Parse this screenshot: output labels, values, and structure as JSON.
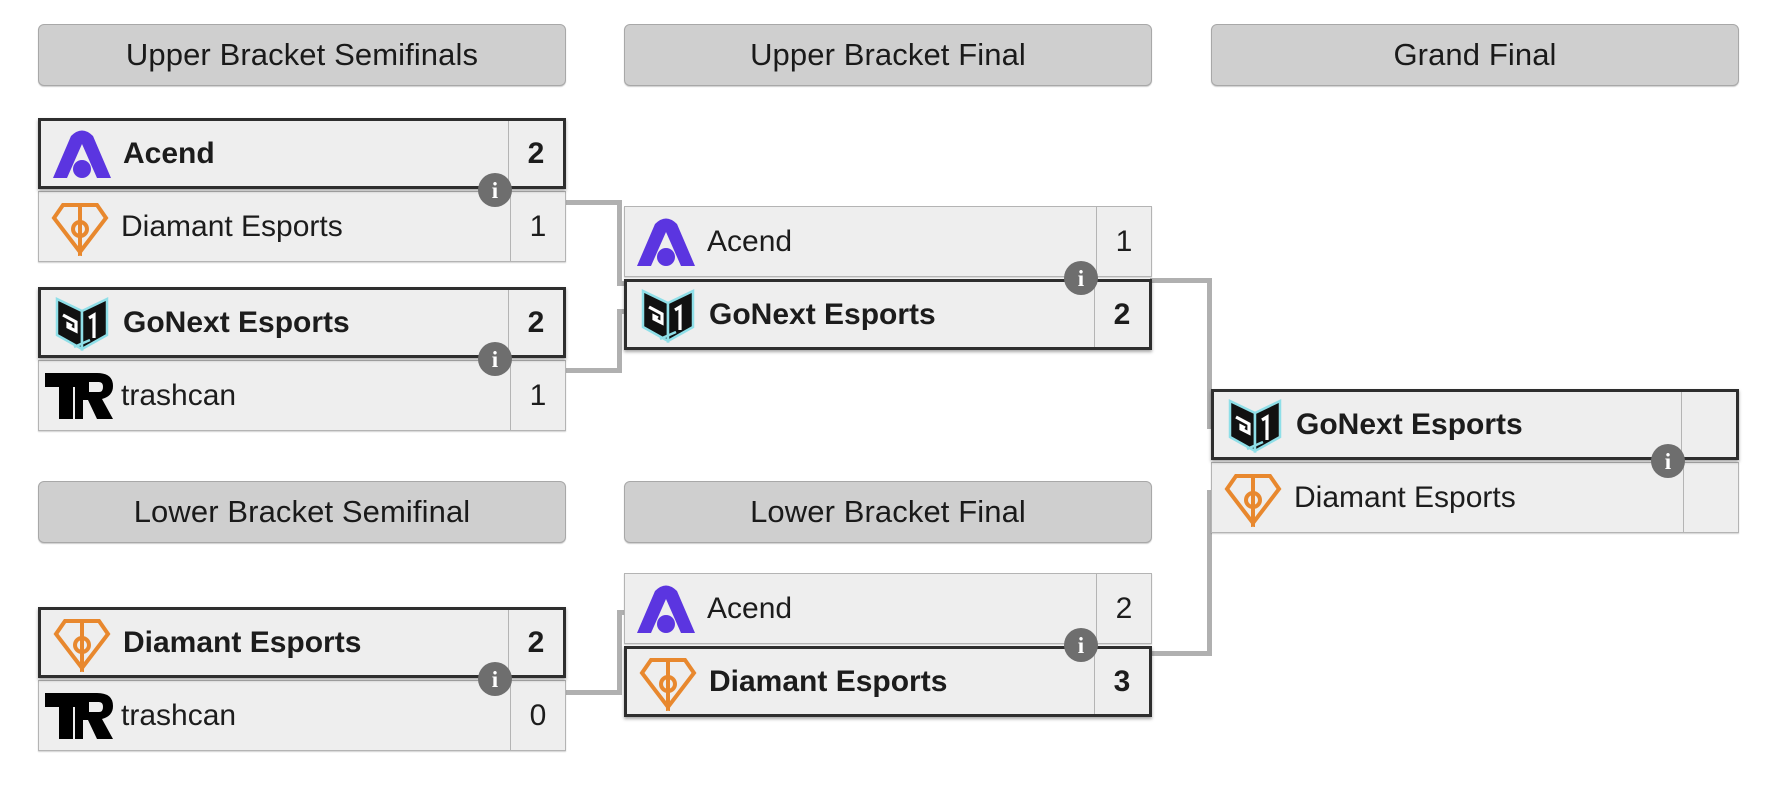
{
  "bracket": {
    "rounds": [
      {
        "id": "upper-bracket-semifinals",
        "label": "Upper Bracket Semifinals"
      },
      {
        "id": "upper-bracket-final",
        "label": "Upper Bracket Final"
      },
      {
        "id": "grand-final",
        "label": "Grand Final"
      },
      {
        "id": "lower-bracket-semifinal",
        "label": "Lower Bracket Semifinal"
      },
      {
        "id": "lower-bracket-final",
        "label": "Lower Bracket Final"
      }
    ],
    "info_icon": "i",
    "matches": [
      {
        "id": "ubsf-1",
        "round": "upper-bracket-semifinals",
        "teams": [
          {
            "name": "Acend",
            "score": "2",
            "winner": true,
            "logo": "acend-logo"
          },
          {
            "name": "Diamant Esports",
            "score": "1",
            "winner": false,
            "logo": "diamant-logo"
          }
        ]
      },
      {
        "id": "ubsf-2",
        "round": "upper-bracket-semifinals",
        "teams": [
          {
            "name": "GoNext Esports",
            "score": "2",
            "winner": true,
            "logo": "gonext-logo"
          },
          {
            "name": "trashcan",
            "score": "1",
            "winner": false,
            "logo": "trashcan-logo"
          }
        ]
      },
      {
        "id": "ubf-1",
        "round": "upper-bracket-final",
        "teams": [
          {
            "name": "Acend",
            "score": "1",
            "winner": false,
            "logo": "acend-logo"
          },
          {
            "name": "GoNext Esports",
            "score": "2",
            "winner": true,
            "logo": "gonext-logo"
          }
        ]
      },
      {
        "id": "gf-1",
        "round": "grand-final",
        "teams": [
          {
            "name": "GoNext Esports",
            "score": "",
            "winner": true,
            "logo": "gonext-logo"
          },
          {
            "name": "Diamant Esports",
            "score": "",
            "winner": false,
            "logo": "diamant-logo"
          }
        ]
      },
      {
        "id": "lbsf-1",
        "round": "lower-bracket-semifinal",
        "teams": [
          {
            "name": "Diamant Esports",
            "score": "2",
            "winner": true,
            "logo": "diamant-logo"
          },
          {
            "name": "trashcan",
            "score": "0",
            "winner": false,
            "logo": "trashcan-logo"
          }
        ]
      },
      {
        "id": "lbf-1",
        "round": "lower-bracket-final",
        "teams": [
          {
            "name": "Acend",
            "score": "2",
            "winner": false,
            "logo": "acend-logo"
          },
          {
            "name": "Diamant Esports",
            "score": "3",
            "winner": true,
            "logo": "diamant-logo"
          }
        ]
      }
    ],
    "colors": {
      "acend_purple": "#5b35e0",
      "diamant_orange": "#e8882e",
      "gonext_cyan": "#8fdfe8",
      "gonext_dark": "#111111",
      "trashcan_black": "#000000",
      "header_background": "#cfcfcf",
      "row_background": "#eeeeee",
      "connector_gray": "#b0b0b0",
      "info_badge_gray": "#6e6e6e"
    }
  }
}
